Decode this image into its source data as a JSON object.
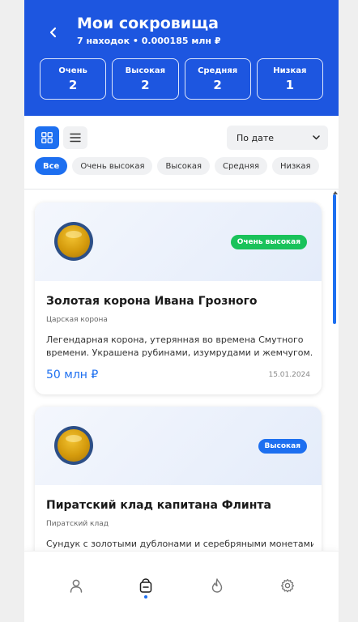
{
  "header": {
    "title": "Мои сокровища",
    "subtitle": "7 находок • 0.000185 млн ₽",
    "stats": [
      {
        "label": "Очень",
        "value": "2"
      },
      {
        "label": "Высокая",
        "value": "2"
      },
      {
        "label": "Средняя",
        "value": "2"
      },
      {
        "label": "Низкая",
        "value": "1"
      }
    ]
  },
  "toolbar": {
    "sort_label": "По дате",
    "filters": [
      "Все",
      "Очень высокая",
      "Высокая",
      "Средняя",
      "Низкая"
    ],
    "active_filter": "Все"
  },
  "treasures": [
    {
      "name": "Золотая корона Ивана Грозного",
      "category": "Царская корона",
      "description_lines": [
        "Легендарная корона, утерянная во времена Смутного",
        "времени. Украшена рубинами, изумрудами и жемчугом..."
      ],
      "value": "50 млн ₽",
      "date": "15.01.2024",
      "badge": "Очень высокая",
      "badge_color": "#19c25a"
    },
    {
      "name": "Пиратский клад капитана Флинта",
      "category": "Пиратский клад",
      "description_lines": [
        "Сундук с золотыми дублонами и серебряными монетами."
      ],
      "value": "",
      "date": "",
      "badge": "Высокая",
      "badge_color": "#1d6ff0"
    }
  ],
  "colors": {
    "header_bg": "#1d56e0",
    "accent": "#1d6ff0"
  },
  "nav": {
    "items": [
      "profile-icon",
      "treasure-icon",
      "fire-icon",
      "gear-icon"
    ],
    "active": "treasure-icon"
  }
}
